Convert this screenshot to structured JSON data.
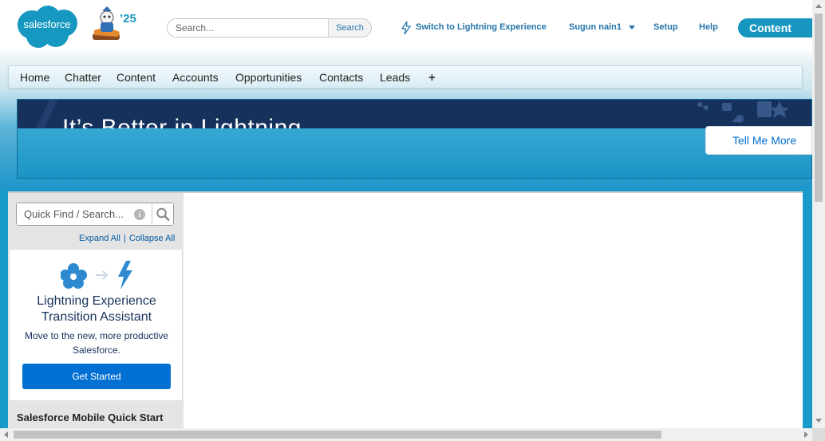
{
  "header": {
    "logo_text": "salesforce",
    "release_badge": "’25",
    "search_placeholder": "Search...",
    "search_button": "Search",
    "switch_lightning": "Switch to Lightning Experience",
    "user_menu": "Sugun nain1",
    "setup": "Setup",
    "help": "Help",
    "app_label": "Content"
  },
  "tabs": [
    {
      "label": "Home"
    },
    {
      "label": "Chatter"
    },
    {
      "label": "Content"
    },
    {
      "label": "Accounts"
    },
    {
      "label": "Opportunities"
    },
    {
      "label": "Contacts"
    },
    {
      "label": "Leads"
    }
  ],
  "tabs_more_symbol": "+",
  "banner": {
    "title": "It’s Better in Lightning",
    "button": "Tell Me More"
  },
  "sidebar": {
    "quickfind_placeholder": "Quick Find / Search...",
    "expand_all": "Expand All",
    "separator": "|",
    "collapse_all": "Collapse All",
    "assistant_title": "Lightning Experience Transition Assistant",
    "assistant_desc": "Move to the new, more productive Salesforce.",
    "assistant_button": "Get Started",
    "mobile_section": "Salesforce Mobile Quick Start"
  },
  "colors": {
    "brand_blue": "#1797c0",
    "link_blue": "#2574a9",
    "lightning_navy": "#16325c",
    "primary_button": "#0070d2"
  }
}
